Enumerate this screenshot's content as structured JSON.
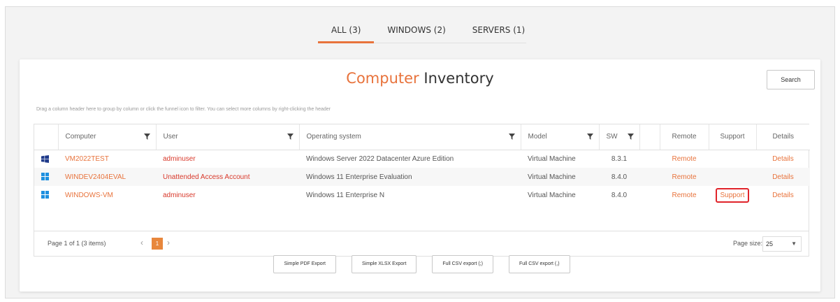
{
  "tabs": [
    {
      "label": "ALL (3)",
      "active": true
    },
    {
      "label": "WINDOWS (2)",
      "active": false
    },
    {
      "label": "SERVERS (1)",
      "active": false
    }
  ],
  "title": {
    "accent": "Computer",
    "rest": " Inventory"
  },
  "search_label": "Search",
  "hint": "Drag a column header here to group by column or click the funnel icon to filter. You can select more columns by right-clicking the header",
  "columns": {
    "computer": "Computer",
    "user": "User",
    "os": "Operating system",
    "model": "Model",
    "sw": "SW",
    "remote": "Remote",
    "support": "Support",
    "details": "Details"
  },
  "rows": [
    {
      "computer": "VM2022TEST",
      "user": "adminuser",
      "os": "Windows Server 2022 Datacenter Azure Edition",
      "model": "Virtual Machine",
      "sw": "8.3.1",
      "remote": "Remote",
      "support": "",
      "details": "Details",
      "icon": "windows-server-icon"
    },
    {
      "computer": "WINDEV2404EVAL",
      "user": "Unattended Access Account",
      "os": "Windows 11 Enterprise Evaluation",
      "model": "Virtual Machine",
      "sw": "8.4.0",
      "remote": "Remote",
      "support": "",
      "details": "Details",
      "icon": "windows-11-icon"
    },
    {
      "computer": "WINDOWS-VM",
      "user": "adminuser",
      "os": "Windows 11 Enterprise N",
      "model": "Virtual Machine",
      "sw": "8.4.0",
      "remote": "Remote",
      "support": "Support",
      "details": "Details",
      "icon": "windows-11-icon"
    }
  ],
  "pager": {
    "info": "Page 1 of 1 (3 items)",
    "current_page": "1",
    "prev": "‹",
    "next": "›",
    "page_size_label": "Page size:",
    "page_size": "25"
  },
  "exports": [
    "Simple PDF Export",
    "Simple XLSX Export",
    "Full CSV export (;)",
    "Full CSV export (,)"
  ],
  "colors": {
    "accent": "#e8733c",
    "user_red": "#d8392b",
    "highlight_box": "#e0242a"
  }
}
